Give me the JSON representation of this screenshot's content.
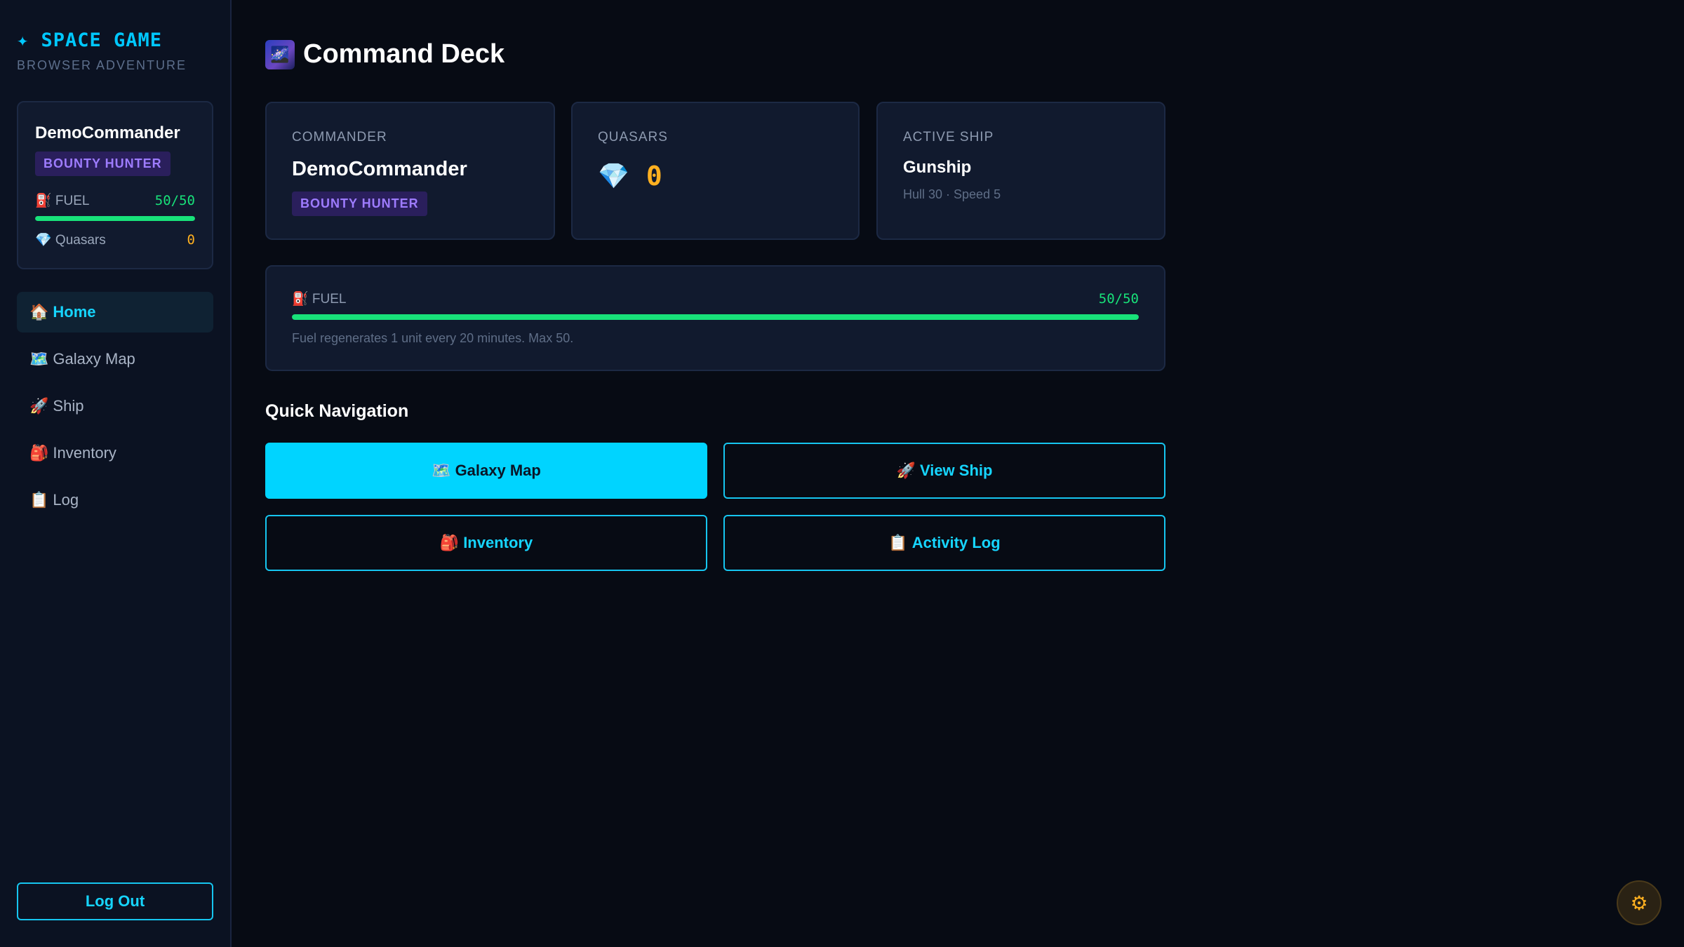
{
  "brand": {
    "title": "✦ SPACE GAME",
    "subtitle": "BROWSER ADVENTURE"
  },
  "profile": {
    "name": "DemoCommander",
    "role": "BOUNTY HUNTER",
    "fuel_label": "⛽ FUEL",
    "fuel_value": "50/50",
    "fuel_fraction": 1.0,
    "quasars_label": "💎 Quasars",
    "quasars_value": "0"
  },
  "nav": {
    "items": [
      {
        "icon": "🏠",
        "label": "Home",
        "active": true
      },
      {
        "icon": "🗺️",
        "label": "Galaxy Map",
        "active": false
      },
      {
        "icon": "🚀",
        "label": "Ship",
        "active": false
      },
      {
        "icon": "🎒",
        "label": "Inventory",
        "active": false
      },
      {
        "icon": "📋",
        "label": "Log",
        "active": false
      }
    ]
  },
  "logout_label": "Log Out",
  "page": {
    "title_icon": "🌌",
    "title": "Command Deck"
  },
  "cards": {
    "commander": {
      "label": "COMMANDER",
      "name": "DemoCommander",
      "badge": "BOUNTY HUNTER"
    },
    "quasars": {
      "label": "QUASARS",
      "icon": "💎",
      "value": "0"
    },
    "ship": {
      "label": "ACTIVE SHIP",
      "name": "Gunship",
      "stats": "Hull 30 · Speed 5"
    }
  },
  "fuel_panel": {
    "label": "⛽ FUEL",
    "value": "50/50",
    "fraction": 1.0,
    "note": "Fuel regenerates 1 unit every 20 minutes. Max 50."
  },
  "quick_nav": {
    "title": "Quick Navigation",
    "buttons": [
      {
        "icon": "🗺️",
        "label": "Galaxy Map"
      },
      {
        "icon": "🚀",
        "label": "View Ship"
      },
      {
        "icon": "🎒",
        "label": "Inventory"
      },
      {
        "icon": "📋",
        "label": "Activity Log"
      }
    ]
  },
  "settings_icon": "⚙",
  "colors": {
    "accent": "#00d4ff",
    "fuel_green": "#18e27a",
    "quasar_orange": "#ffb020",
    "badge_purple": "#9e7cff",
    "background": "#070b14"
  }
}
